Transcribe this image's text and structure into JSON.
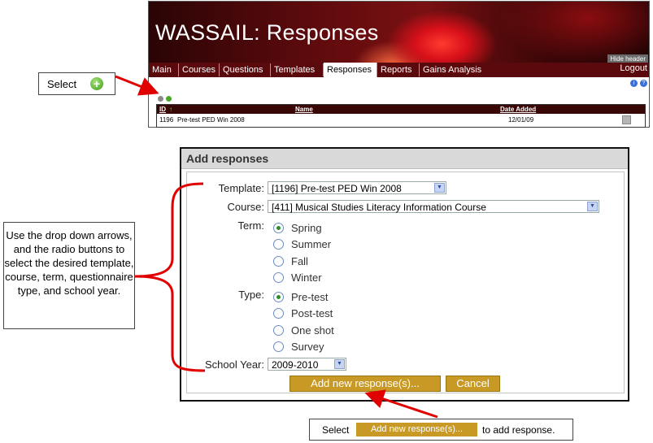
{
  "app": {
    "title": "WASSAIL: Responses",
    "hide_header": "Hide header",
    "nav_tabs": [
      "Main",
      "Courses",
      "Questions",
      "Templates",
      "Responses",
      "Reports",
      "Gains Analysis"
    ],
    "active_tab": "Responses",
    "logout": "Logout",
    "grid": {
      "columns": [
        "ID",
        "Name",
        "Date Added"
      ],
      "rows": [
        {
          "id": "1196",
          "name": "Pre-test PED Win 2008",
          "date": "12/01/09"
        }
      ]
    }
  },
  "dialog": {
    "title": "Add responses",
    "template_label": "Template:",
    "template_value": "[1196] Pre-test PED Win 2008",
    "course_label": "Course:",
    "course_value": "[411] Musical Studies Literacy Information Course",
    "term_label": "Term:",
    "term_options": [
      "Spring",
      "Summer",
      "Fall",
      "Winter"
    ],
    "term_selected": "Spring",
    "type_label": "Type:",
    "type_options": [
      "Pre-test",
      "Post-test",
      "One shot",
      "Survey"
    ],
    "type_selected": "Pre-test",
    "school_year_label": "School Year:",
    "school_year_value": "2009-2010",
    "add_button": "Add new response(s)...",
    "cancel_button": "Cancel"
  },
  "annotations": {
    "select_label": "Select",
    "instructions": "Use the drop down arrows, and the radio buttons to select the desired template, course, term, questionnaire type, and school year.",
    "bottom_select": "Select",
    "bottom_button": "Add new response(s)...",
    "bottom_suffix": "to add response."
  },
  "colors": {
    "accent_red": "#e00000",
    "button_gold": "#c89a25",
    "nav_dark": "#5a0a0c"
  }
}
